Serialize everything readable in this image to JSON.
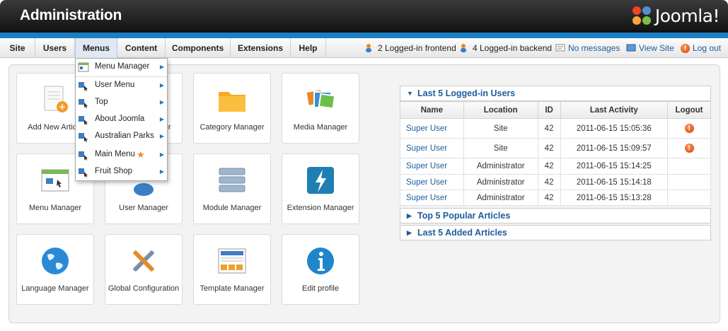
{
  "header": {
    "title": "Administration",
    "logo_text": "Joomla!"
  },
  "menubar": {
    "items": [
      {
        "label": "Site"
      },
      {
        "label": "Users"
      },
      {
        "label": "Menus"
      },
      {
        "label": "Content"
      },
      {
        "label": "Components"
      },
      {
        "label": "Extensions"
      },
      {
        "label": "Help"
      }
    ],
    "status": {
      "frontend": "2 Logged-in frontend",
      "backend": "4 Logged-in backend",
      "messages": "No messages",
      "view_site": "View Site",
      "logout": "Log out"
    }
  },
  "dropdown": {
    "items": [
      {
        "label": "Menu Manager"
      },
      {
        "label": "User Menu"
      },
      {
        "label": "Top"
      },
      {
        "label": "About Joomla"
      },
      {
        "label": "Australian Parks"
      },
      {
        "label": "Main Menu"
      },
      {
        "label": "Fruit Shop"
      }
    ]
  },
  "tiles": [
    {
      "label": "Add New Article"
    },
    {
      "label": "Article Manager"
    },
    {
      "label": "Category Manager"
    },
    {
      "label": "Media Manager"
    },
    {
      "label": "Menu Manager"
    },
    {
      "label": "User Manager"
    },
    {
      "label": "Module Manager"
    },
    {
      "label": "Extension Manager"
    },
    {
      "label": "Language Manager"
    },
    {
      "label": "Global Configuration"
    },
    {
      "label": "Template Manager"
    },
    {
      "label": "Edit profile"
    }
  ],
  "logged_in": {
    "title": "Last 5 Logged-in Users",
    "columns": [
      "Name",
      "Location",
      "ID",
      "Last Activity",
      "Logout"
    ],
    "rows": [
      {
        "name": "Super User",
        "location": "Site",
        "id": "42",
        "activity": "2011-06-15 15:05:36",
        "logout": "!"
      },
      {
        "name": "Super User",
        "location": "Site",
        "id": "42",
        "activity": "2011-06-15 15:09:57",
        "logout": "!"
      },
      {
        "name": "Super User",
        "location": "Administrator",
        "id": "42",
        "activity": "2011-06-15 15:14:25",
        "logout": ""
      },
      {
        "name": "Super User",
        "location": "Administrator",
        "id": "42",
        "activity": "2011-06-15 15:14:18",
        "logout": ""
      },
      {
        "name": "Super User",
        "location": "Administrator",
        "id": "42",
        "activity": "2011-06-15 15:13:28",
        "logout": ""
      }
    ]
  },
  "popular": {
    "title": "Top 5 Popular Articles"
  },
  "added": {
    "title": "Last 5 Added Articles"
  },
  "colors": {
    "accent": "#1a7fc4",
    "link": "#1d5d9b",
    "header": "#222222"
  }
}
